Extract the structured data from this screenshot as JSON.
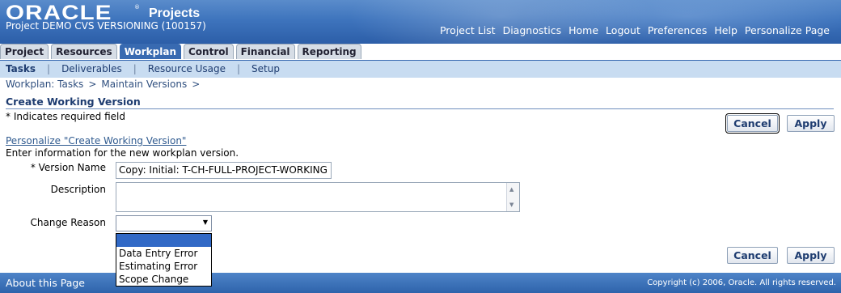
{
  "header": {
    "logo_text": "ORACLE",
    "app_name": "Projects",
    "project_title": "Project DEMO CVS VERSIONING (100157)",
    "global_links": [
      "Project List",
      "Diagnostics",
      "Home",
      "Logout",
      "Preferences",
      "Help",
      "Personalize Page"
    ]
  },
  "tabs": [
    {
      "label": "Project",
      "active": false
    },
    {
      "label": "Resources",
      "active": false
    },
    {
      "label": "Workplan",
      "active": true
    },
    {
      "label": "Control",
      "active": false
    },
    {
      "label": "Financial",
      "active": false
    },
    {
      "label": "Reporting",
      "active": false
    }
  ],
  "subtabs": [
    {
      "label": "Tasks",
      "active": true
    },
    {
      "label": "Deliverables",
      "active": false
    },
    {
      "label": "Resource Usage",
      "active": false
    },
    {
      "label": "Setup",
      "active": false
    }
  ],
  "breadcrumb": [
    "Workplan: Tasks",
    "Maintain Versions"
  ],
  "breadcrumb_separator": ">",
  "page": {
    "title": "Create Working Version",
    "required_note": "*  Indicates required field",
    "personalize_link": "Personalize \"Create Working Version\"",
    "instruction": "Enter information for the new workplan version.",
    "buttons": {
      "cancel": "Cancel",
      "apply": "Apply"
    }
  },
  "form": {
    "version_name": {
      "label": "* Version Name",
      "value": "Copy: Initial: T-CH-FULL-PROJECT-WORKING"
    },
    "description": {
      "label": "Description",
      "value": ""
    },
    "change_reason": {
      "label": "Change Reason",
      "selected": "",
      "options": [
        "",
        "Data Entry Error",
        "Estimating Error",
        "Scope Change"
      ]
    }
  },
  "footer": {
    "about": "About this Page",
    "copyright": "Copyright (c) 2006, Oracle. All rights reserved."
  },
  "colors": {
    "header_blue": "#3e74bd",
    "active_tab": "#386ab1",
    "subnav_bg": "#c8dcf1",
    "dropdown_highlight": "#3169c6"
  }
}
